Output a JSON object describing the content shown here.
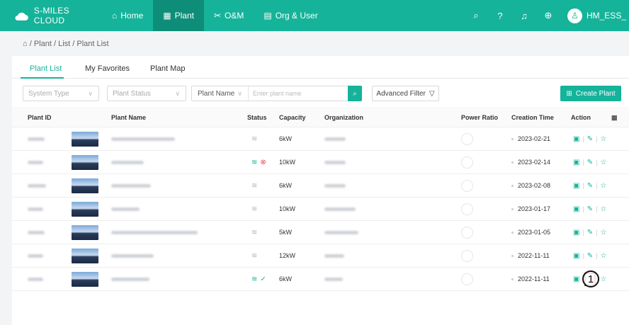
{
  "topbar": {
    "brand": "S-MILES CLOUD",
    "nav": [
      {
        "label": "Home",
        "icon": "home-icon",
        "active": false
      },
      {
        "label": "Plant",
        "icon": "plant-icon",
        "active": true
      },
      {
        "label": "O&M",
        "icon": "tools-icon",
        "active": false
      },
      {
        "label": "Org & User",
        "icon": "org-icon",
        "active": false
      }
    ],
    "username": "HM_ESS_"
  },
  "breadcrumb": "/ Plant / List / Plant List",
  "tabs": [
    "Plant List",
    "My Favorites",
    "Plant Map"
  ],
  "filters": {
    "system_type": "System Type",
    "plant_status": "Plant Status",
    "plant_name_label": "Plant Name",
    "plant_name_placeholder": "Enter plant name",
    "advanced_filter": "Advanced Filter",
    "create_plant": "Create Plant"
  },
  "columns": [
    "Plant ID",
    "Plant Name",
    "Status",
    "Capacity",
    "Organization",
    "Power Ratio",
    "Creation Time",
    "Action"
  ],
  "rows": [
    {
      "capacity": "6kW",
      "created": "2023-02-21",
      "status": "offline"
    },
    {
      "capacity": "10kW",
      "created": "2023-02-14",
      "status": "alarm"
    },
    {
      "capacity": "6kW",
      "created": "2023-02-08",
      "status": "offline"
    },
    {
      "capacity": "10kW",
      "created": "2023-01-17",
      "status": "offline"
    },
    {
      "capacity": "5kW",
      "created": "2023-01-05",
      "status": "offline"
    },
    {
      "capacity": "12kW",
      "created": "2022-11-11",
      "status": "offline"
    },
    {
      "capacity": "6kW",
      "created": "2022-11-11",
      "status": "normal"
    }
  ],
  "annotation": "1",
  "colors": {
    "accent": "#15b39a",
    "alarm": "#e64848",
    "highlight": "#e02020"
  }
}
